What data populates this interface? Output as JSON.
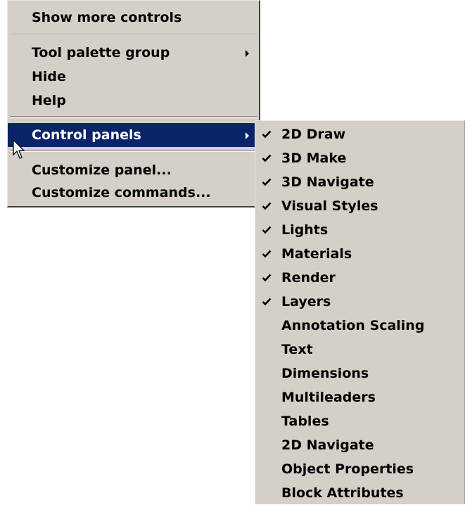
{
  "context_menu": {
    "items": [
      {
        "label": "Show more controls"
      },
      {
        "label": "Tool palette group",
        "has_submenu": true
      },
      {
        "label": "Hide"
      },
      {
        "label": "Help"
      },
      {
        "label": "Control panels",
        "has_submenu": true,
        "highlighted": true
      },
      {
        "label": "Customize panel..."
      },
      {
        "label": "Customize commands..."
      }
    ]
  },
  "control_panels_submenu": {
    "items": [
      {
        "label": "2D Draw",
        "checked": true
      },
      {
        "label": "3D Make",
        "checked": true
      },
      {
        "label": "3D Navigate",
        "checked": true
      },
      {
        "label": "Visual Styles",
        "checked": true
      },
      {
        "label": "Lights",
        "checked": true
      },
      {
        "label": "Materials",
        "checked": true
      },
      {
        "label": "Render",
        "checked": true
      },
      {
        "label": "Layers",
        "checked": true
      },
      {
        "label": "Annotation Scaling",
        "checked": false
      },
      {
        "label": "Text",
        "checked": false
      },
      {
        "label": "Dimensions",
        "checked": false
      },
      {
        "label": "Multileaders",
        "checked": false
      },
      {
        "label": "Tables",
        "checked": false
      },
      {
        "label": "2D Navigate",
        "checked": false
      },
      {
        "label": "Object Properties",
        "checked": false
      },
      {
        "label": "Block Attributes",
        "checked": false
      }
    ]
  },
  "colors": {
    "menu_background": "#d4d0c8",
    "highlight_background": "#0a246a",
    "highlight_text": "#ffffff"
  },
  "icons": {
    "check": "checkmark-icon",
    "submenu": "submenu-arrow-icon",
    "cursor": "mouse-pointer-icon"
  }
}
